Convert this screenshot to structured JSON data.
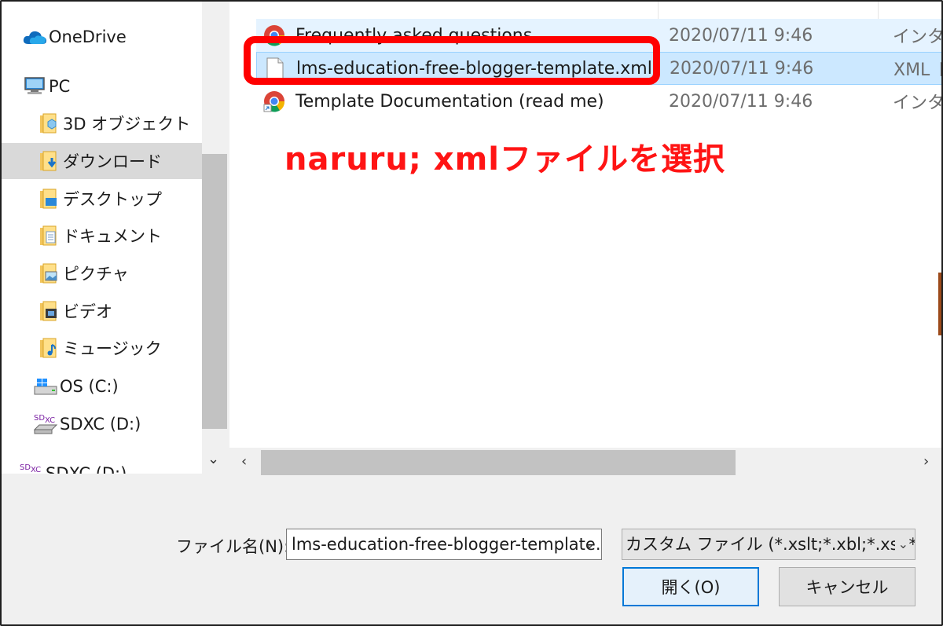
{
  "nav": {
    "items": [
      {
        "label": "OneDrive",
        "icon": "onedrive-cloud-icon"
      },
      {
        "label": "PC",
        "icon": "pc-icon"
      },
      {
        "label": "3D オブジェクト",
        "icon": "3d-objects-folder-icon"
      },
      {
        "label": "ダウンロード",
        "icon": "downloads-folder-icon",
        "selected": true
      },
      {
        "label": "デスクトップ",
        "icon": "desktop-folder-icon"
      },
      {
        "label": "ドキュメント",
        "icon": "documents-folder-icon"
      },
      {
        "label": "ピクチャ",
        "icon": "pictures-folder-icon"
      },
      {
        "label": "ビデオ",
        "icon": "videos-folder-icon"
      },
      {
        "label": "ミュージック",
        "icon": "music-folder-icon"
      },
      {
        "label": "OS (C:)",
        "icon": "windows-drive-icon"
      },
      {
        "label": "SDXC (D:)",
        "icon": "sdxc-drive-icon",
        "badge": "SDXC"
      },
      {
        "label": "SDXC (D:)",
        "icon": "sdxc-drive-icon",
        "badge": "SDXC"
      }
    ]
  },
  "files": [
    {
      "name": "Frequently asked questions",
      "date": "2020/07/11 9:46",
      "type": "インター",
      "icon": "chrome-shortcut-icon"
    },
    {
      "name": "lms-education-free-blogger-template.xml",
      "date": "2020/07/11 9:46",
      "type": "XML ド",
      "icon": "xml-file-icon",
      "selected": true
    },
    {
      "name": "Template Documentation (read me)",
      "date": "2020/07/11 9:46",
      "type": "インター",
      "icon": "chrome-shortcut-icon"
    }
  ],
  "annotation": "naruru; xmlファイルを選択",
  "footer": {
    "filename_label": "ファイル名(N):",
    "filename_value": "lms-education-free-blogger-template.xml",
    "filetype_value": "カスタム ファイル (*.xslt;*.xbl;*.xsl;*.xml)",
    "open_label": "開く(O)",
    "cancel_label": "キャンセル"
  },
  "colors": {
    "highlight": "#ff0000",
    "selection": "#cce8ff",
    "primary_border": "#0078d7"
  }
}
